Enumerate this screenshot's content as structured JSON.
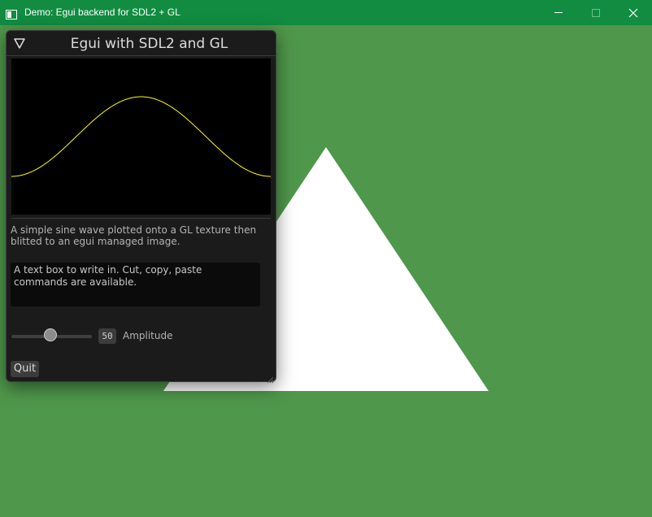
{
  "os_window": {
    "title": "Demo: Egui backend for SDL2 + GL",
    "app_icon": "window-app-icon",
    "controls": {
      "minimize_icon": "minimize-icon",
      "maximize_icon": "maximize-icon",
      "close_icon": "close-icon"
    },
    "titlebar_color": "#118c41"
  },
  "scene": {
    "clear_color": "#4f974b",
    "shape": "triangle",
    "shape_color": "#ffffff"
  },
  "egui_window": {
    "title": "Egui with SDL2 and GL",
    "collapse_icon": "collapse-triangle-icon",
    "plot": {
      "description": "sine wave",
      "line_color": "#ffff00",
      "background_color": "#000000"
    },
    "caption": "A simple sine wave plotted onto a GL texture then blitted to an egui managed image.",
    "text_box": {
      "value": "A text box to write in. Cut, copy, paste commands are available."
    },
    "amplitude_slider": {
      "value": "50",
      "label": "Amplitude"
    },
    "quit_button": {
      "label": "Quit"
    },
    "resize_icon": "resize-grip-icon"
  }
}
